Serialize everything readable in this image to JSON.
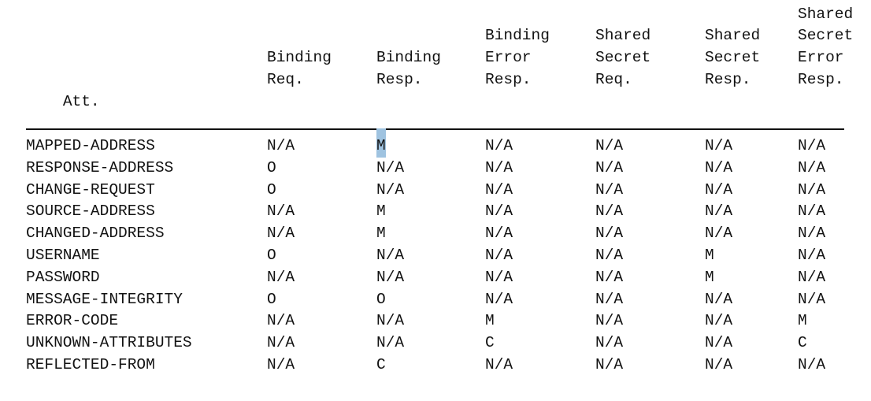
{
  "document": {
    "kind": "plain-text-table",
    "colors": {
      "text": "#121212",
      "background": "#ffffff",
      "rule": "#111111",
      "selection_highlight": "#9fc3e0"
    }
  },
  "table": {
    "corner_header": "Att.",
    "column_headers": [
      {
        "id": "binding-req",
        "lines": [
          "Binding",
          "Req."
        ]
      },
      {
        "id": "binding-resp",
        "lines": [
          "Binding",
          "Resp."
        ]
      },
      {
        "id": "binding-error-resp",
        "lines": [
          "Binding",
          "Error",
          "Resp."
        ]
      },
      {
        "id": "shared-secret-req",
        "lines": [
          "Shared",
          "Secret",
          "Req."
        ]
      },
      {
        "id": "shared-secret-resp",
        "lines": [
          "Shared",
          "Secret",
          "Resp."
        ]
      },
      {
        "id": "shared-secret-err-resp",
        "lines": [
          "Shared",
          "Secret",
          "Error",
          "Resp."
        ]
      }
    ],
    "rows": [
      {
        "attribute": "MAPPED-ADDRESS",
        "values": [
          "N/A",
          "M",
          "N/A",
          "N/A",
          "N/A",
          "N/A"
        ]
      },
      {
        "attribute": "RESPONSE-ADDRESS",
        "values": [
          "O",
          "N/A",
          "N/A",
          "N/A",
          "N/A",
          "N/A"
        ]
      },
      {
        "attribute": "CHANGE-REQUEST",
        "values": [
          "O",
          "N/A",
          "N/A",
          "N/A",
          "N/A",
          "N/A"
        ]
      },
      {
        "attribute": "SOURCE-ADDRESS",
        "values": [
          "N/A",
          "M",
          "N/A",
          "N/A",
          "N/A",
          "N/A"
        ]
      },
      {
        "attribute": "CHANGED-ADDRESS",
        "values": [
          "N/A",
          "M",
          "N/A",
          "N/A",
          "N/A",
          "N/A"
        ]
      },
      {
        "attribute": "USERNAME",
        "values": [
          "O",
          "N/A",
          "N/A",
          "N/A",
          "M",
          "N/A"
        ]
      },
      {
        "attribute": "PASSWORD",
        "values": [
          "N/A",
          "N/A",
          "N/A",
          "N/A",
          "M",
          "N/A"
        ]
      },
      {
        "attribute": "MESSAGE-INTEGRITY",
        "values": [
          "O",
          "O",
          "N/A",
          "N/A",
          "N/A",
          "N/A"
        ]
      },
      {
        "attribute": "ERROR-CODE",
        "values": [
          "N/A",
          "N/A",
          "M",
          "N/A",
          "N/A",
          "M"
        ]
      },
      {
        "attribute": "UNKNOWN-ATTRIBUTES",
        "values": [
          "N/A",
          "N/A",
          "C",
          "N/A",
          "N/A",
          "C"
        ]
      },
      {
        "attribute": "REFLECTED-FROM",
        "values": [
          "N/A",
          "C",
          "N/A",
          "N/A",
          "N/A",
          "N/A"
        ]
      }
    ],
    "selection": {
      "row_index": 0,
      "column_index": 1,
      "value": "M"
    }
  }
}
